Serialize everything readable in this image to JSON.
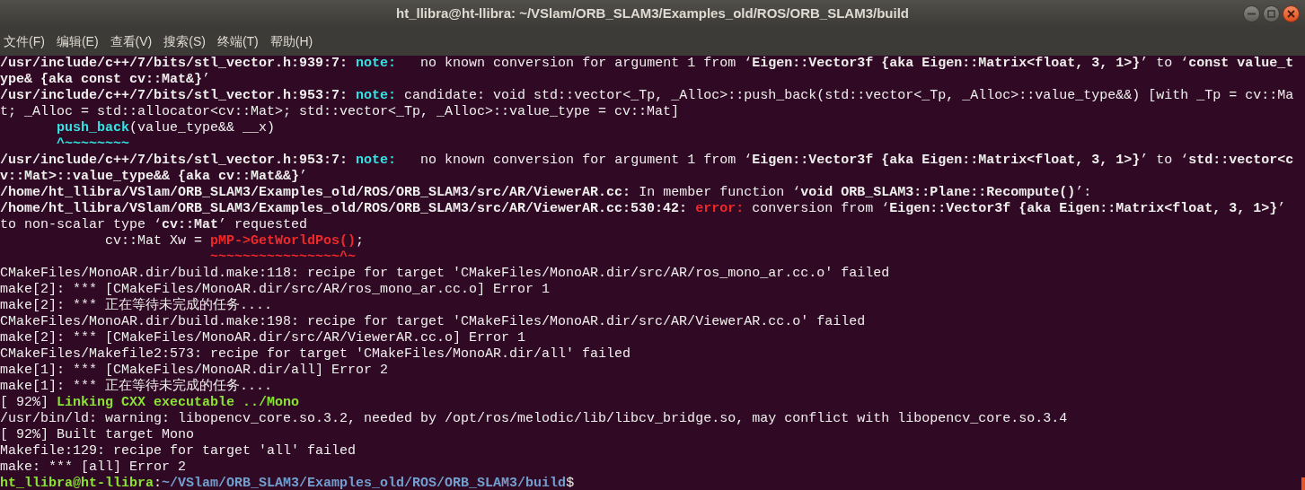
{
  "window": {
    "title": "ht_llibra@ht-llibra: ~/VSlam/ORB_SLAM3/Examples_old/ROS/ORB_SLAM3/build"
  },
  "menu": [
    "文件(F)",
    "编辑(E)",
    "查看(V)",
    "搜索(S)",
    "终端(T)",
    "帮助(H)"
  ],
  "terminal": {
    "lines": [
      [
        {
          "text": "/usr/include/c++/7/bits/stl_vector.h:939:7: ",
          "kind": "bold"
        },
        {
          "text": "note:",
          "kind": "note"
        },
        {
          "text": "   no known conversion for argument 1 from ‘",
          "kind": "plain"
        },
        {
          "text": "Eigen::Vector3f {aka Eigen::Matrix<float, 3, 1>}",
          "kind": "bold"
        },
        {
          "text": "’ to ‘",
          "kind": "plain"
        },
        {
          "text": "const value_t",
          "kind": "bold"
        }
      ],
      [
        {
          "text": "ype& {aka const cv::Mat&}",
          "kind": "bold"
        },
        {
          "text": "’",
          "kind": "plain"
        }
      ],
      [
        {
          "text": "/usr/include/c++/7/bits/stl_vector.h:953:7: ",
          "kind": "bold"
        },
        {
          "text": "note:",
          "kind": "note"
        },
        {
          "text": " candidate: void std::vector<_Tp, _Alloc>::push_back(std::vector<_Tp, _Alloc>::value_type&&) [with _Tp = cv::Ma",
          "kind": "plain"
        }
      ],
      [
        {
          "text": "t; _Alloc = std::allocator<cv::Mat>; std::vector<_Tp, _Alloc>::value_type = cv::Mat]",
          "kind": "plain"
        }
      ],
      [
        {
          "text": "       push_back",
          "kind": "cyan"
        },
        {
          "text": "(value_type&& __x)",
          "kind": "plain"
        }
      ],
      [
        {
          "text": "       ^~~~~~~~~",
          "kind": "cyan"
        }
      ],
      [
        {
          "text": "/usr/include/c++/7/bits/stl_vector.h:953:7: ",
          "kind": "bold"
        },
        {
          "text": "note:",
          "kind": "note"
        },
        {
          "text": "   no known conversion for argument 1 from ‘",
          "kind": "plain"
        },
        {
          "text": "Eigen::Vector3f {aka Eigen::Matrix<float, 3, 1>}",
          "kind": "bold"
        },
        {
          "text": "’ to ‘",
          "kind": "plain"
        },
        {
          "text": "std::vector<c",
          "kind": "bold"
        }
      ],
      [
        {
          "text": "v::Mat>::value_type&& {aka cv::Mat&&}",
          "kind": "bold"
        },
        {
          "text": "’",
          "kind": "plain"
        }
      ],
      [
        {
          "text": "/home/ht_llibra/VSlam/ORB_SLAM3/Examples_old/ROS/ORB_SLAM3/src/AR/ViewerAR.cc:",
          "kind": "bold"
        },
        {
          "text": " In member function ‘",
          "kind": "plain"
        },
        {
          "text": "void ORB_SLAM3::Plane::Recompute()",
          "kind": "bold"
        },
        {
          "text": "’:",
          "kind": "plain"
        }
      ],
      [
        {
          "text": "/home/ht_llibra/VSlam/ORB_SLAM3/Examples_old/ROS/ORB_SLAM3/src/AR/ViewerAR.cc:530:42: ",
          "kind": "bold"
        },
        {
          "text": "error:",
          "kind": "error"
        },
        {
          "text": " conversion from ‘",
          "kind": "plain"
        },
        {
          "text": "Eigen::Vector3f {aka Eigen::Matrix<float, 3, 1>}",
          "kind": "bold"
        },
        {
          "text": "’",
          "kind": "plain"
        }
      ],
      [
        {
          "text": "to non-scalar type ‘",
          "kind": "plain"
        },
        {
          "text": "cv::Mat",
          "kind": "bold"
        },
        {
          "text": "’ requested",
          "kind": "plain"
        }
      ],
      [
        {
          "text": "             cv::Mat Xw = ",
          "kind": "plain"
        },
        {
          "text": "pMP->GetWorldPos()",
          "kind": "red"
        },
        {
          "text": ";",
          "kind": "plain"
        }
      ],
      [
        {
          "text": "                          ~~~~~~~~~~~~~~~~^~",
          "kind": "red"
        }
      ],
      [
        {
          "text": "CMakeFiles/MonoAR.dir/build.make:118: recipe for target 'CMakeFiles/MonoAR.dir/src/AR/ros_mono_ar.cc.o' failed",
          "kind": "plain"
        }
      ],
      [
        {
          "text": "make[2]: *** [CMakeFiles/MonoAR.dir/src/AR/ros_mono_ar.cc.o] Error 1",
          "kind": "plain"
        }
      ],
      [
        {
          "text": "make[2]: *** 正在等待未完成的任务....",
          "kind": "plain"
        }
      ],
      [
        {
          "text": "CMakeFiles/MonoAR.dir/build.make:198: recipe for target 'CMakeFiles/MonoAR.dir/src/AR/ViewerAR.cc.o' failed",
          "kind": "plain"
        }
      ],
      [
        {
          "text": "make[2]: *** [CMakeFiles/MonoAR.dir/src/AR/ViewerAR.cc.o] Error 1",
          "kind": "plain"
        }
      ],
      [
        {
          "text": "CMakeFiles/Makefile2:573: recipe for target 'CMakeFiles/MonoAR.dir/all' failed",
          "kind": "plain"
        }
      ],
      [
        {
          "text": "make[1]: *** [CMakeFiles/MonoAR.dir/all] Error 2",
          "kind": "plain"
        }
      ],
      [
        {
          "text": "make[1]: *** 正在等待未完成的任务....",
          "kind": "plain"
        }
      ],
      [
        {
          "text": "[ 92%] ",
          "kind": "plain"
        },
        {
          "text": "Linking CXX executable ../Mono",
          "kind": "green"
        }
      ],
      [
        {
          "text": "/usr/bin/ld: warning: libopencv_core.so.3.2, needed by /opt/ros/melodic/lib/libcv_bridge.so, may conflict with libopencv_core.so.3.4",
          "kind": "plain"
        }
      ],
      [
        {
          "text": "[ 92%] Built target Mono",
          "kind": "plain"
        }
      ],
      [
        {
          "text": "Makefile:129: recipe for target 'all' failed",
          "kind": "plain"
        }
      ],
      [
        {
          "text": "make: *** [all] Error 2",
          "kind": "plain"
        }
      ],
      [
        {
          "text": "ht_llibra@ht-llibra",
          "kind": "green"
        },
        {
          "text": ":",
          "kind": "plain"
        },
        {
          "text": "~/VSlam/ORB_SLAM3/Examples_old/ROS/ORB_SLAM3/build",
          "kind": "blue"
        },
        {
          "text": "$",
          "kind": "plain"
        }
      ]
    ]
  }
}
